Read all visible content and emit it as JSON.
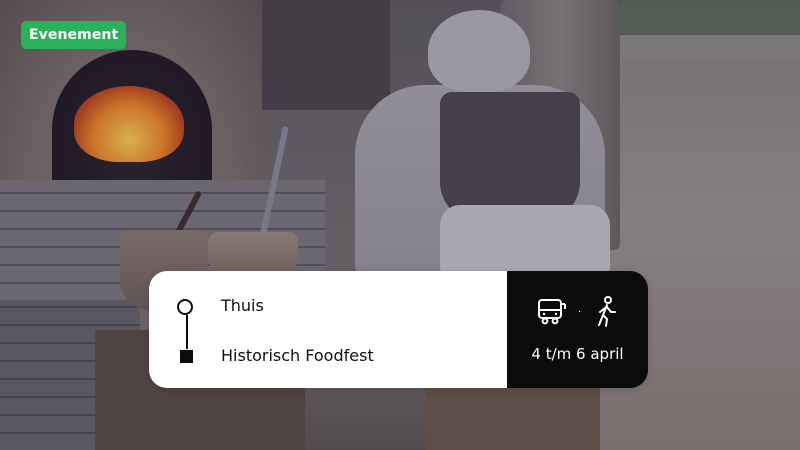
{
  "badge": {
    "label": "Evenement",
    "color": "#2bb15a"
  },
  "route": {
    "from": "Thuis",
    "to": "Historisch Foodfest",
    "start_icon": "route-start-circle-icon",
    "end_icon": "route-end-square-icon"
  },
  "transport": {
    "modes": [
      "bus-icon",
      "walk-icon"
    ],
    "separator": "·",
    "dates": "4 t/m 6 april"
  },
  "colors": {
    "card_bg": "#ffffff",
    "panel_bg": "#0b0b0b",
    "badge_green": "#2bb15a"
  }
}
